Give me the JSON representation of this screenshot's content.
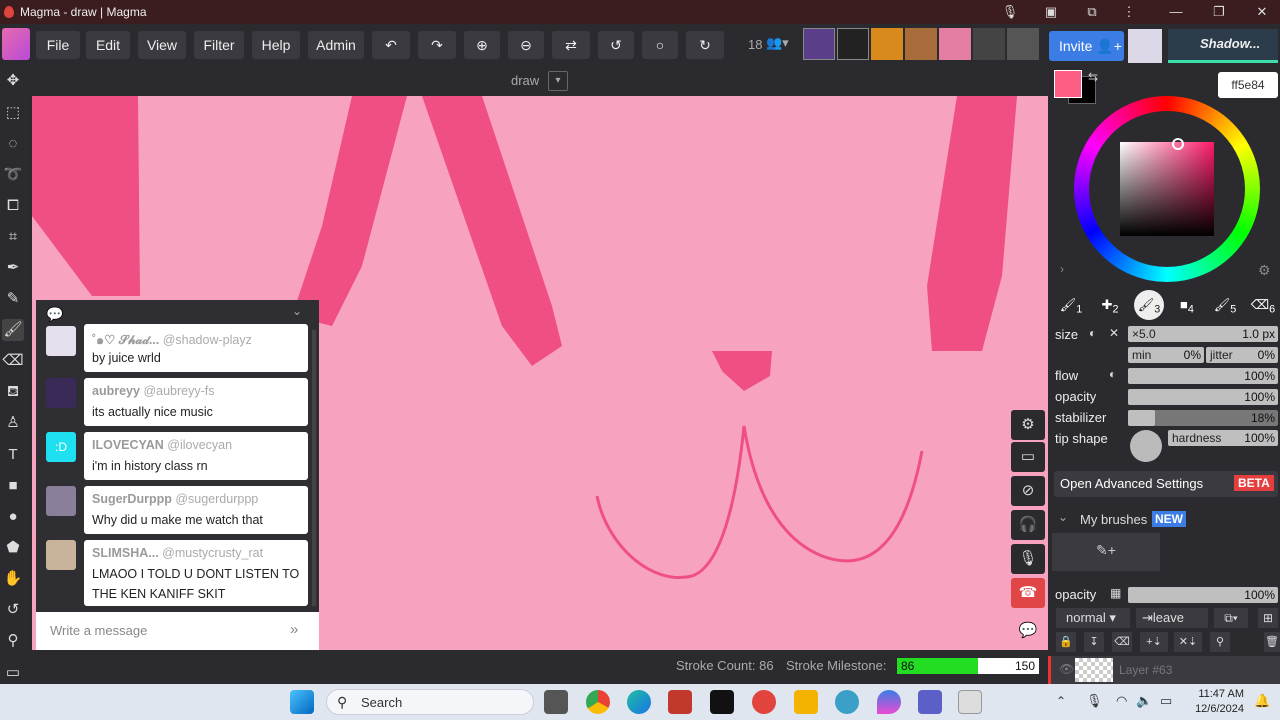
{
  "window": {
    "title": "Magma - draw | Magma"
  },
  "menu": {
    "file": "File",
    "edit": "Edit",
    "view": "View",
    "filter": "Filter",
    "help": "Help",
    "admin": "Admin",
    "user_count": "18",
    "invite": "Invite",
    "username": "Shadow..."
  },
  "canvas": {
    "name": "draw"
  },
  "color": {
    "current": "#ff5e84",
    "hex_label": "ff5e84",
    "secondary": "#000000"
  },
  "brushes": {
    "slots": [
      "1",
      "2",
      "3",
      "4",
      "5",
      "6"
    ]
  },
  "settings": {
    "size_label": "size",
    "size_mult": "×5.0",
    "size_value": "1.0 px",
    "min_label": "min",
    "min_value": "0%",
    "jitter_label": "jitter",
    "jitter_value": "0%",
    "flow_label": "flow",
    "flow_value": "100%",
    "flow_level": 1.0,
    "opacity_label": "opacity",
    "opacity_value": "100%",
    "opacity_level": 1.0,
    "stabilizer_label": "stabilizer",
    "stabilizer_value": "18%",
    "stabilizer_level": 0.18,
    "tip_label": "tip shape",
    "hardness_label": "hardness",
    "hardness_value": "100%",
    "advanced": "Open Advanced Settings",
    "beta": "BETA",
    "my_brushes": "My brushes",
    "new_badge": "NEW"
  },
  "layers": {
    "opacity_label": "opacity",
    "opacity_value": "100%",
    "blend": "normal",
    "leave": "leave",
    "current_layer": "Layer #63"
  },
  "chat": {
    "messages": [
      {
        "name": "˚๑♡ 𝒮𝒽𝒶𝒹...",
        "handle": "@shadow-playz",
        "text": "by juice wrld"
      },
      {
        "name": "aubreyy",
        "handle": "@aubreyy-fs",
        "text": "its actually nice music"
      },
      {
        "name": "ILOVECYAN",
        "handle": "@ilovecyan",
        "text": "i'm in history class rn",
        "avatar_text": ":D"
      },
      {
        "name": "SugerDurppp",
        "handle": "@sugerdurppp",
        "text": "Why did u make me watch that"
      },
      {
        "name": "SLIMSHA...",
        "handle": "@mustycrusty_rat",
        "text": "LMAOO I TOLD U DONT LISTEN TO THE KEN KANIFF SKIT"
      }
    ],
    "placeholder": "Write a message"
  },
  "status": {
    "stroke_count": "Stroke Count: 86",
    "milestone_label": "Stroke Milestone:",
    "milestone_value": "86",
    "milestone_target": "150",
    "milestone_progress": 0.573
  },
  "taskbar": {
    "search": "Search",
    "time": "11:47 AM",
    "date": "12/6/2024"
  }
}
